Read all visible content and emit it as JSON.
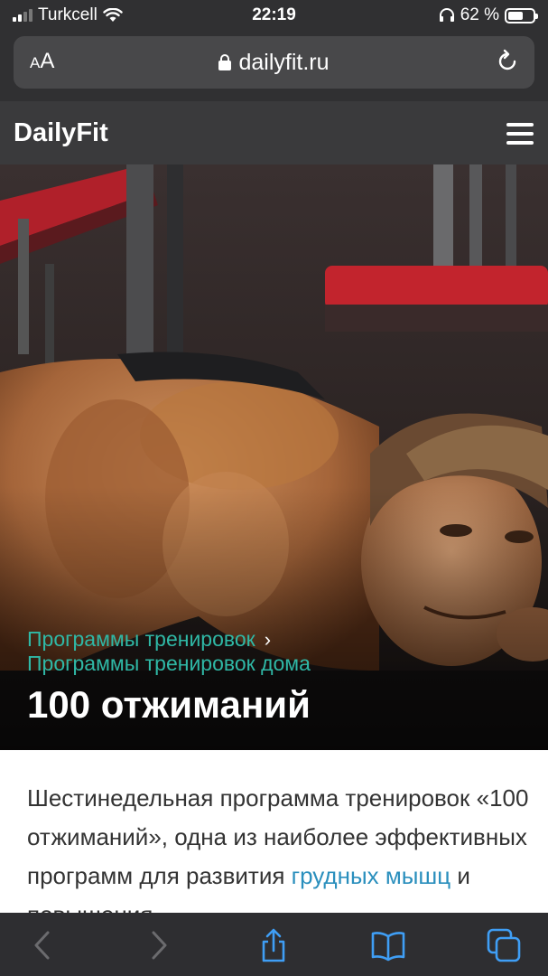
{
  "status_bar": {
    "carrier": "Turkcell",
    "time": "22:19",
    "battery_percent": "62 %",
    "battery_level": 0.62,
    "icons": [
      "signal-icon",
      "wifi-icon",
      "headphones-icon",
      "battery-icon"
    ]
  },
  "address_bar": {
    "aa_label_small": "A",
    "aa_label_large": "A",
    "url": "dailyfit.ru"
  },
  "site": {
    "logo": "DailyFit"
  },
  "hero": {
    "breadcrumb_1": "Программы тренировок",
    "breadcrumb_sep": "›",
    "breadcrumb_2": "Программы тренировок дома",
    "title": "100 отжиманий"
  },
  "article": {
    "text_before_link": "Шестинедельная программа тренировок «100 отжиманий», одна из наиболее эффективных программ для развития ",
    "link_text": "грудных мышц",
    "text_after_link": " и повышения"
  },
  "colors": {
    "accent_teal": "#2fb8a6",
    "link_blue": "#2a8fbd",
    "toolbar_blue": "#3f9ef5"
  }
}
